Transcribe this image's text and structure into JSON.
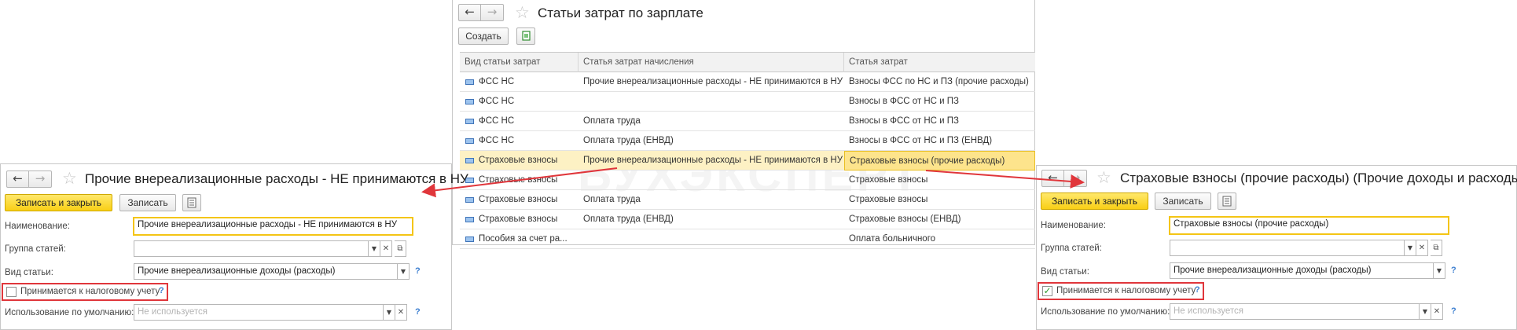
{
  "center": {
    "title": "Статьи затрат по зарплате",
    "create_label": "Создать",
    "columns": [
      "Вид статьи затрат",
      "Статья затрат начисления",
      "Статья затрат"
    ],
    "rows": [
      [
        "ФСС НС",
        "Прочие внереализационные расходы - НЕ принимаются в НУ",
        "Взносы ФСС по НС и ПЗ (прочие расходы)"
      ],
      [
        "ФСС НС",
        "",
        "Взносы в ФСС от НС и ПЗ"
      ],
      [
        "ФСС НС",
        "Оплата труда",
        "Взносы в ФСС от НС и ПЗ"
      ],
      [
        "ФСС НС",
        "Оплата труда (ЕНВД)",
        "Взносы в ФСС от НС и ПЗ (ЕНВД)"
      ],
      [
        "Страховые взносы",
        "Прочие внереализационные расходы - НЕ принимаются в НУ",
        "Страховые взносы (прочие расходы)"
      ],
      [
        "Страховые взносы",
        "",
        "Страховые взносы"
      ],
      [
        "Страховые взносы",
        "Оплата труда",
        "Страховые взносы"
      ],
      [
        "Страховые взносы",
        "Оплата труда (ЕНВД)",
        "Страховые взносы (ЕНВД)"
      ],
      [
        "Пособия за счет ра...",
        "",
        "Оплата больничного"
      ]
    ],
    "selected_row": 4,
    "watermark": "БУХЭКСПЕРТ"
  },
  "left": {
    "title": "Прочие внереализационные расходы - НЕ принимаются в НУ",
    "save_close_label": "Записать и закрыть",
    "save_label": "Записать",
    "name_label": "Наименование:",
    "name_value": "Прочие внереализационные расходы - НЕ принимаются в НУ",
    "group_label": "Группа статей:",
    "group_value": "",
    "kind_label": "Вид статьи:",
    "kind_value": "Прочие внереализационные доходы (расходы)",
    "tax_label": "Принимается к налоговому учету",
    "tax_checked": false,
    "default_label": "Использование по умолчанию:",
    "default_placeholder": "Не используется",
    "help": "?"
  },
  "right": {
    "title": "Страховые взносы (прочие расходы) (Прочие доходы и расходы)",
    "save_close_label": "Записать и закрыть",
    "save_label": "Записать",
    "name_label": "Наименование:",
    "name_value": "Страховые взносы (прочие расходы)",
    "group_label": "Группа статей:",
    "group_value": "",
    "kind_label": "Вид статьи:",
    "kind_value": "Прочие внереализационные доходы (расходы)",
    "tax_label": "Принимается к налоговому учету",
    "tax_checked": true,
    "default_label": "Использование по умолчанию:",
    "default_placeholder": "Не используется",
    "help": "?"
  },
  "colors": {
    "accent_yellow": "#f9cf15",
    "highlight_red": "#e0363b",
    "selected_row": "#fdf1c4",
    "checkmark_green": "#2b9a2b"
  }
}
